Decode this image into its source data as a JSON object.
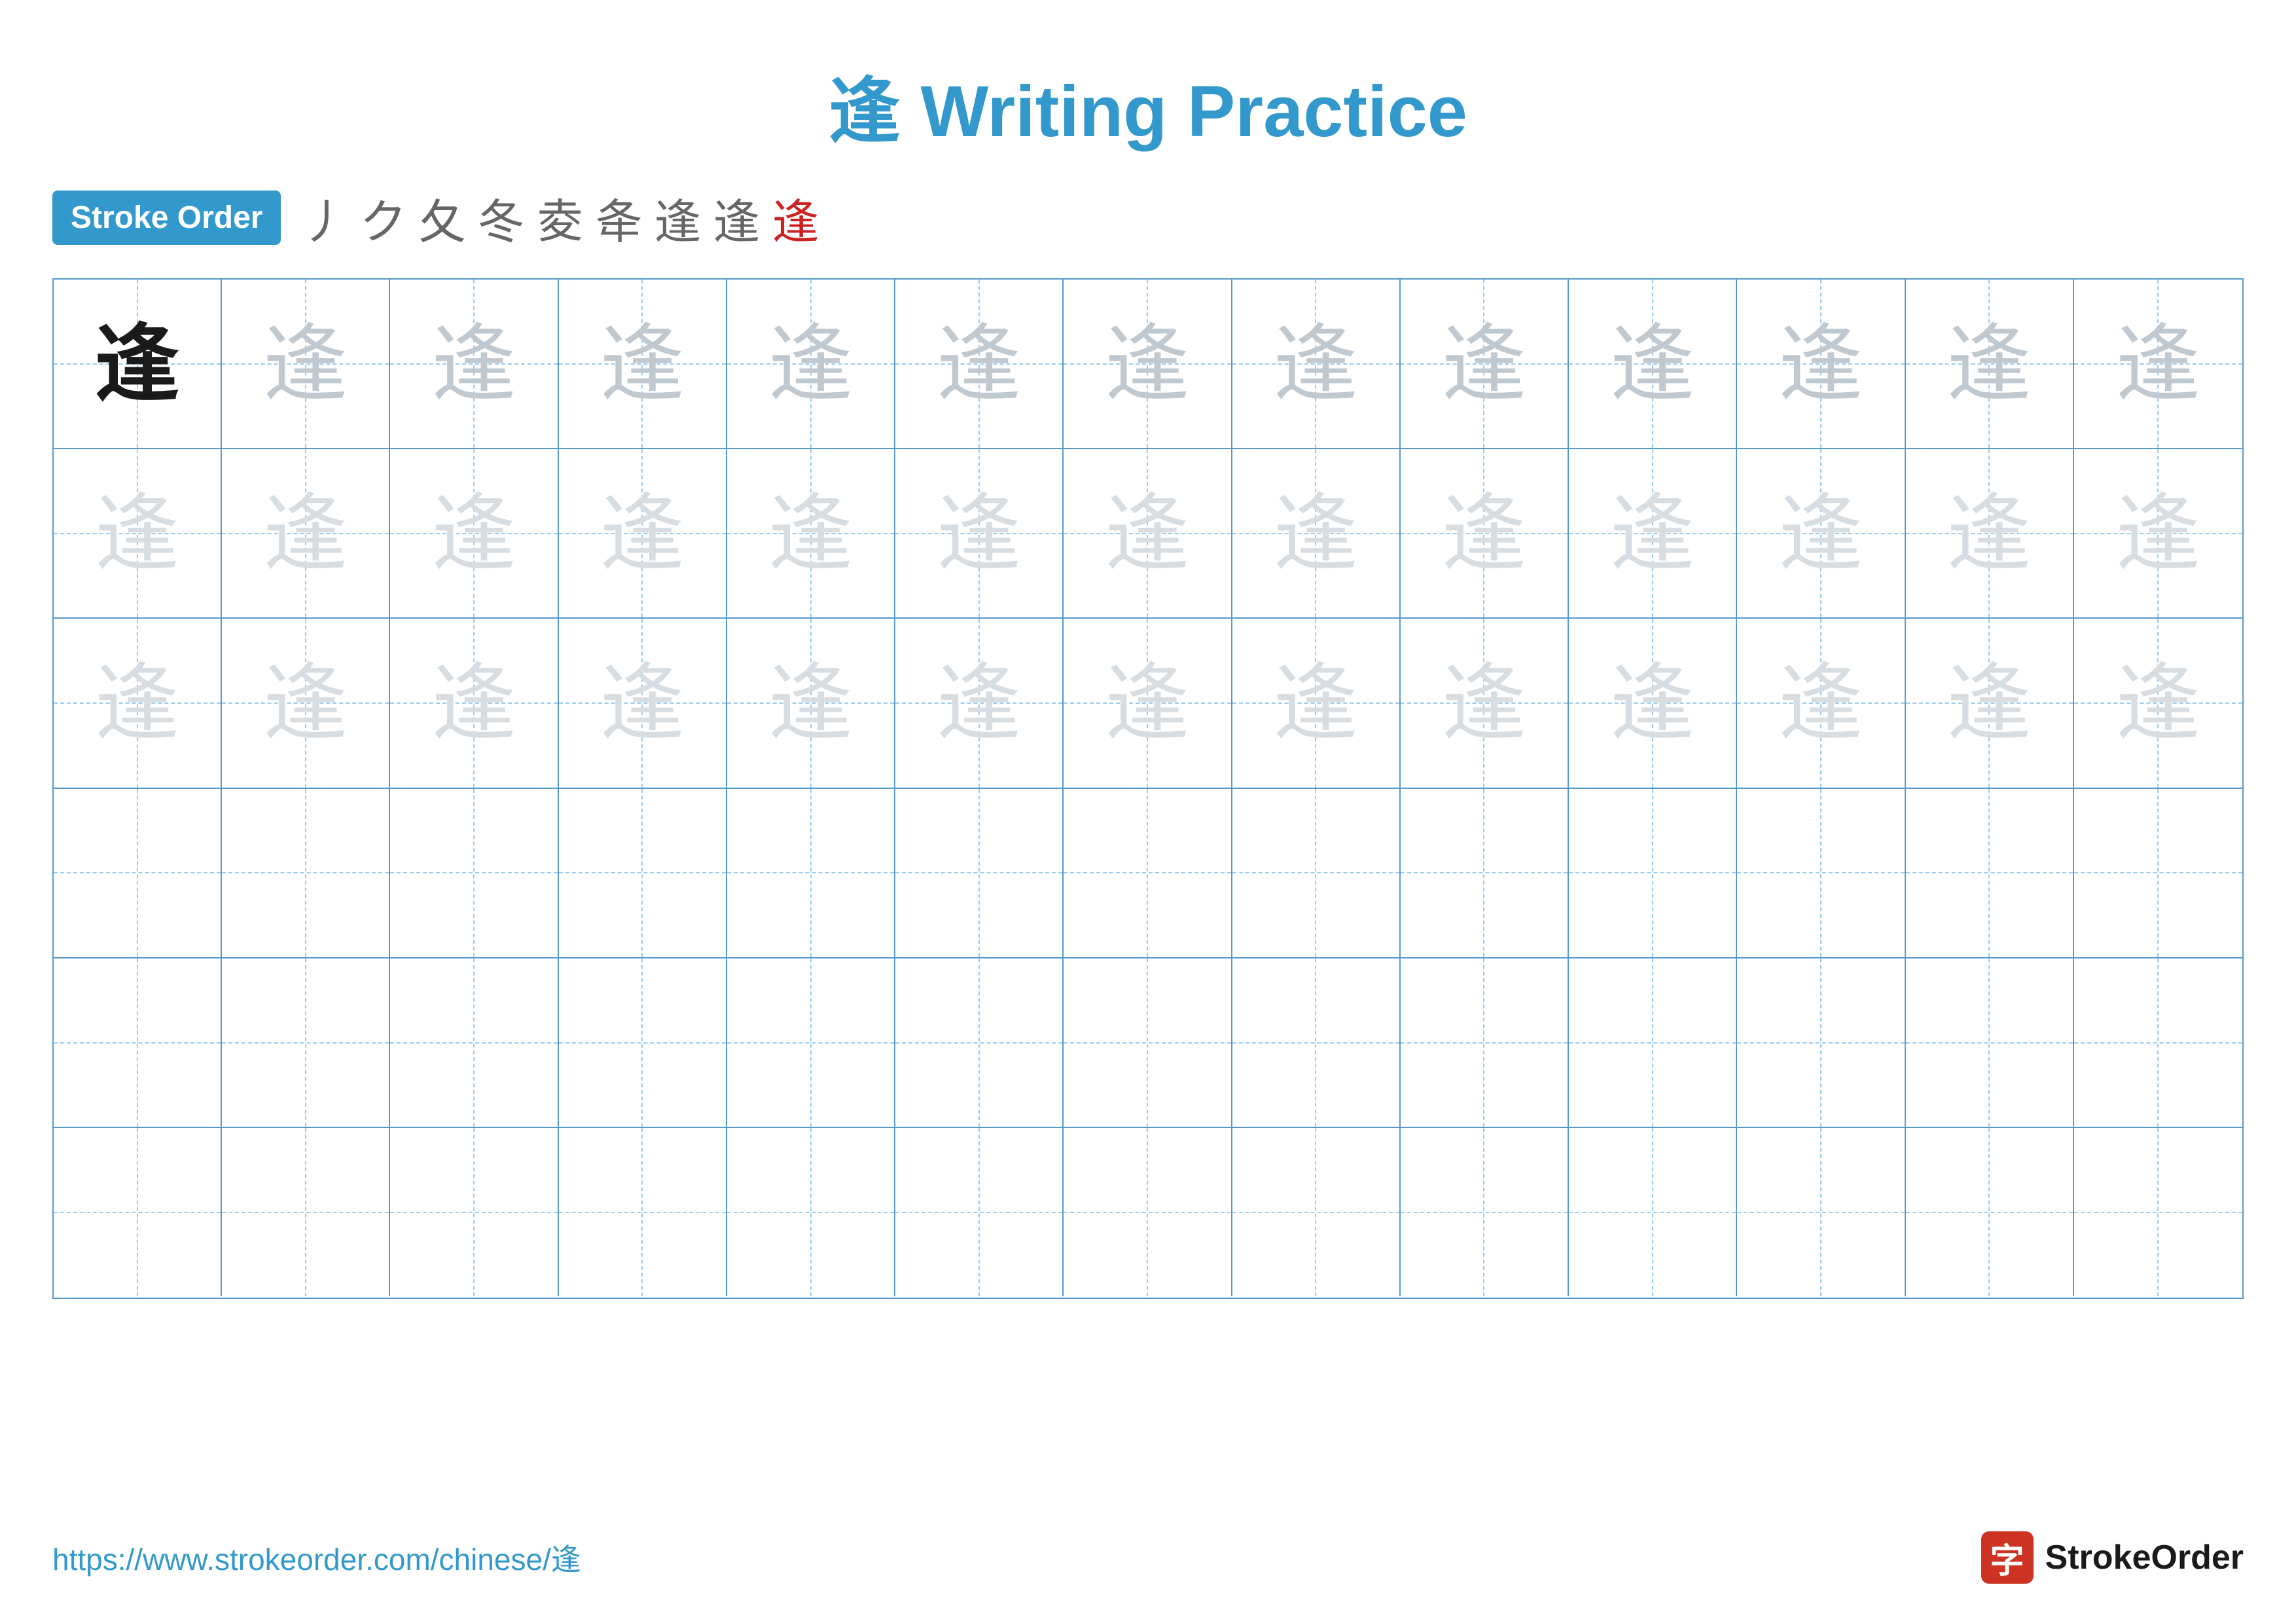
{
  "header": {
    "char": "逢",
    "title_text": " Writing Practice"
  },
  "stroke_order": {
    "badge_label": "Stroke Order",
    "strokes": [
      "丿",
      "ク",
      "夂",
      "冬",
      "夌",
      "夅",
      "夆",
      "逢",
      "逢"
    ],
    "last_red_index": 8
  },
  "grid": {
    "rows": 6,
    "cols": 13,
    "char": "逢",
    "filled_rows": [
      [
        true,
        true,
        true,
        true,
        true,
        true,
        true,
        true,
        true,
        true,
        true,
        true,
        true
      ],
      [
        true,
        true,
        true,
        true,
        true,
        true,
        true,
        true,
        true,
        true,
        true,
        true,
        true
      ],
      [
        true,
        true,
        true,
        true,
        true,
        true,
        true,
        true,
        true,
        true,
        true,
        true,
        true
      ],
      [
        false,
        false,
        false,
        false,
        false,
        false,
        false,
        false,
        false,
        false,
        false,
        false,
        false
      ],
      [
        false,
        false,
        false,
        false,
        false,
        false,
        false,
        false,
        false,
        false,
        false,
        false,
        false
      ],
      [
        false,
        false,
        false,
        false,
        false,
        false,
        false,
        false,
        false,
        false,
        false,
        false,
        false
      ]
    ],
    "row_styles": [
      "first-row",
      "second-row",
      "third-row",
      "empty",
      "empty",
      "empty"
    ]
  },
  "footer": {
    "url": "https://www.strokeorder.com/chinese/逢",
    "logo_char": "字",
    "logo_name": "StrokeOrder"
  }
}
